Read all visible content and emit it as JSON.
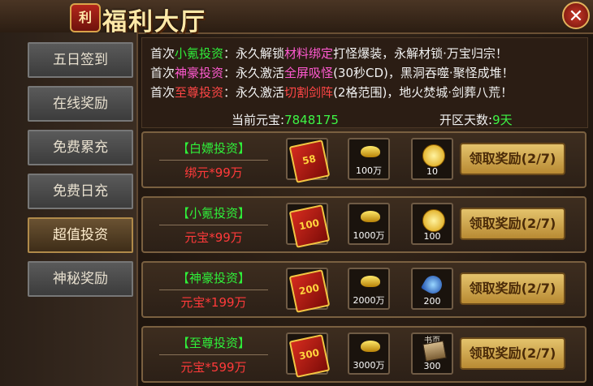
{
  "window": {
    "badge": "利",
    "title": "福利大厅",
    "close_glyph": "✕"
  },
  "sidebar": {
    "items": [
      {
        "label": "五日签到"
      },
      {
        "label": "在线奖励"
      },
      {
        "label": "免费累充"
      },
      {
        "label": "免费日充"
      },
      {
        "label": "超值投资"
      },
      {
        "label": "神秘奖励"
      }
    ],
    "active_index": 4
  },
  "info": {
    "lines": [
      {
        "prefix": "首次",
        "tier": "小氪投资",
        "mid": "：永久解锁",
        "feature": "材料绑定",
        "rest": "打怪爆装，永解材锁·万宝归宗！"
      },
      {
        "prefix": "首次",
        "tier": "神豪投资",
        "mid": "：永久激活",
        "feature": "全屏吸怪",
        "rest": "(30秒CD)，黑洞吞噬·聚怪成堆！"
      },
      {
        "prefix": "首次",
        "tier": "至尊投资",
        "mid": "：永久激活",
        "feature": "切割剑阵",
        "rest": "(2格范围)，地火焚城·剑葬八荒！"
      }
    ],
    "yuanbao_label": "当前元宝:",
    "yuanbao_value": "7848175",
    "days_label": "开区天数:",
    "days_value": "9天"
  },
  "rows": [
    {
      "name": "【白嫖投资】",
      "price": "绑元*99万",
      "env_num": "58",
      "gold_amount": "100万",
      "item_icon": "coin-icon",
      "item_amount": "10",
      "button": "领取奖励(2/7)"
    },
    {
      "name": "【小氪投资】",
      "price": "元宝*99万",
      "env_num": "100",
      "gold_amount": "1000万",
      "item_icon": "coin-icon",
      "item_amount": "100",
      "button": "领取奖励(2/7)"
    },
    {
      "name": "【神豪投资】",
      "price": "元宝*199万",
      "env_num": "200",
      "gold_amount": "2000万",
      "item_icon": "gem-icon",
      "item_amount": "200",
      "button": "领取奖励(2/7)"
    },
    {
      "name": "【至尊投资】",
      "price": "元宝*599万",
      "env_num": "300",
      "gold_amount": "3000万",
      "item_icon": "book-icon",
      "item_label": "书页",
      "item_amount": "300",
      "button": "领取奖励(2/7)"
    }
  ]
}
